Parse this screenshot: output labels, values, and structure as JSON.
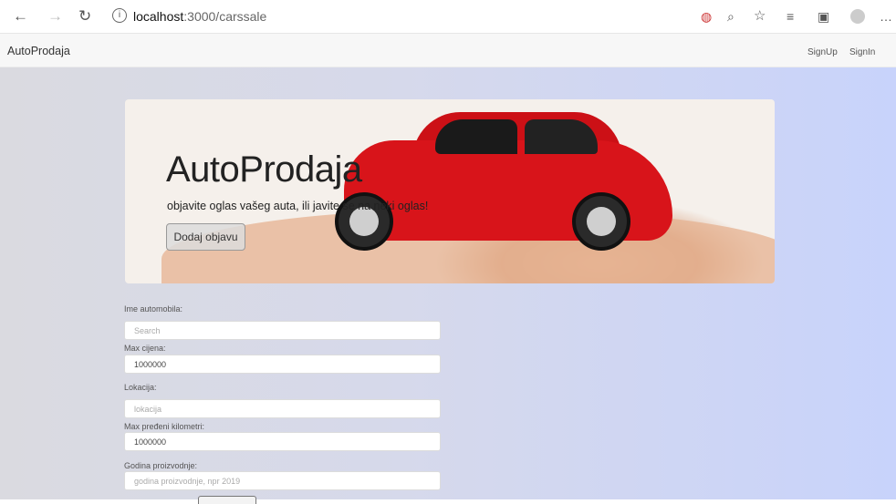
{
  "browser": {
    "url_host": "localhost",
    "url_path": ":3000/carssale",
    "icons": [
      "back-arrow-icon",
      "forward-arrow-icon",
      "refresh-icon",
      "info-icon",
      "tracking-icon",
      "zoom-icon",
      "favorite-star-icon",
      "favorites-list-icon",
      "collections-icon",
      "profile-icon",
      "more-icon"
    ]
  },
  "navbar": {
    "brand": "AutoProdaja",
    "links": [
      "SignUp",
      "SignIn"
    ]
  },
  "hero": {
    "title": "AutoProdaja",
    "subtitle": "objavite oglas vašeg auta, ili javite se na neki oglas!",
    "button": "Dodaj objavu"
  },
  "form": {
    "name_label": "Ime automobila:",
    "name_placeholder": "Search",
    "price_label": "Max cijena:",
    "price_value": "1000000",
    "location_label": "Lokacija:",
    "location_placeholder": "lokacija",
    "km_label": "Max pređeni kilometri:",
    "km_value": "1000000",
    "year_label": "Godina proizvodnje:",
    "year_placeholder": "godina proizvodnje, npr 2019"
  },
  "colors": {
    "car_red": "#d8141a",
    "bg_right": "#c8d3fb",
    "bg_left": "#dadae0"
  }
}
